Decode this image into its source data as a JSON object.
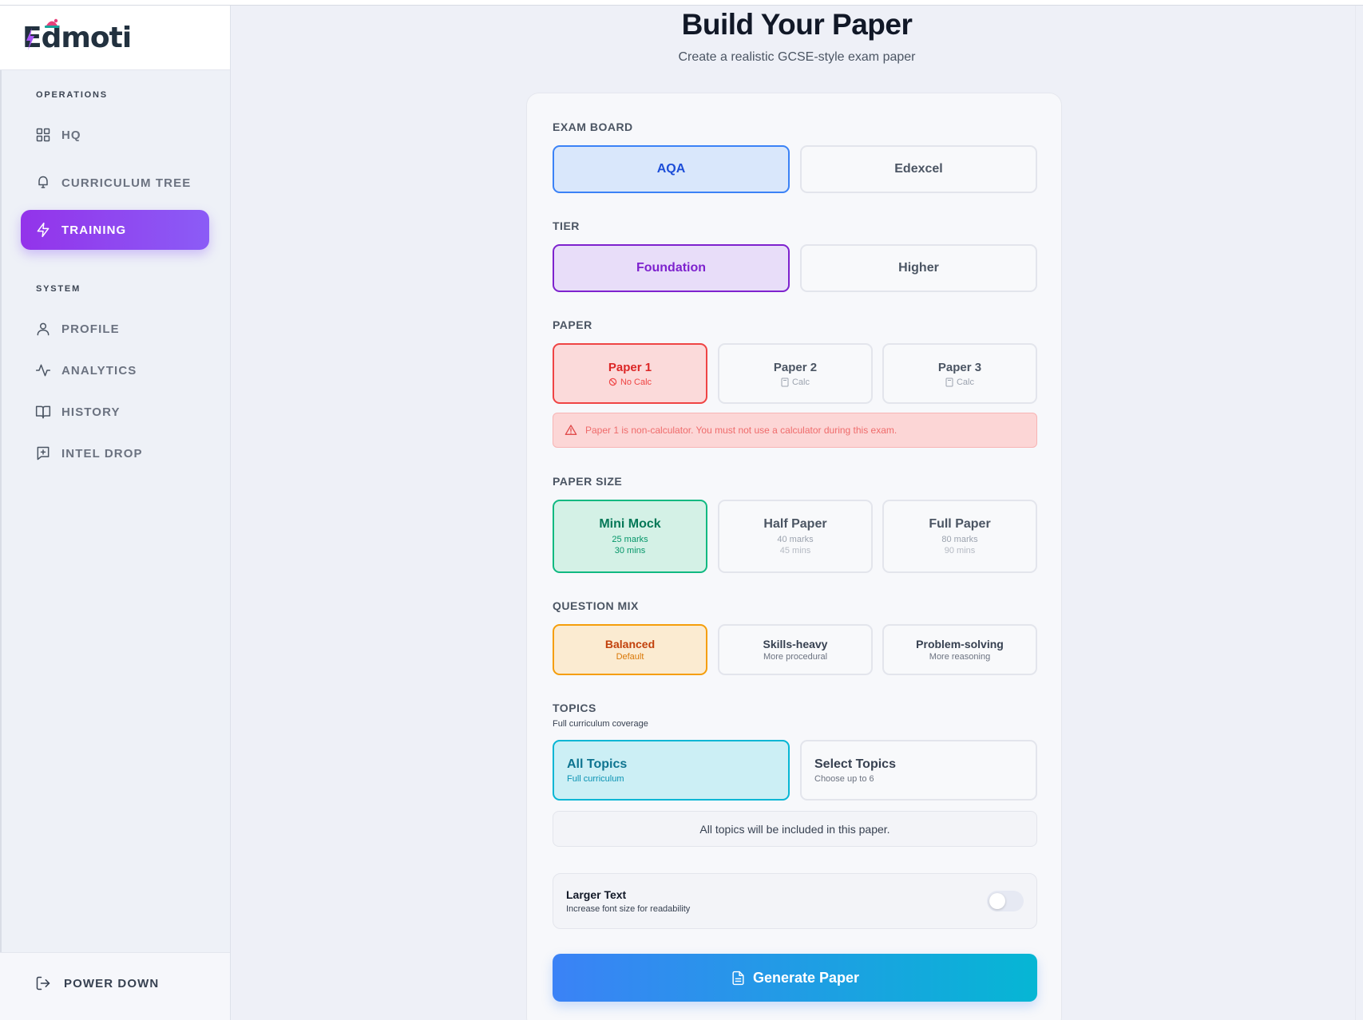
{
  "brand": {
    "name": "Edmoti"
  },
  "sidebar": {
    "sections": {
      "operations": "OPERATIONS",
      "system": "SYSTEM"
    },
    "items": [
      {
        "label": "HQ",
        "icon": "grid-icon"
      },
      {
        "label": "CURRICULUM TREE",
        "icon": "tree-icon"
      },
      {
        "label": "TRAINING",
        "icon": "lightning-icon",
        "active": true
      },
      {
        "label": "PROFILE",
        "icon": "user-icon"
      },
      {
        "label": "ANALYTICS",
        "icon": "activity-icon"
      },
      {
        "label": "HISTORY",
        "icon": "book-icon"
      },
      {
        "label": "INTEL DROP",
        "icon": "message-plus-icon"
      }
    ],
    "power_down": "POWER DOWN"
  },
  "page": {
    "title": "Build Your Paper",
    "subtitle": "Create a realistic GCSE-style exam paper"
  },
  "exam_board": {
    "label": "EXAM BOARD",
    "options": [
      "AQA",
      "Edexcel"
    ],
    "selected": "AQA"
  },
  "tier": {
    "label": "TIER",
    "options": [
      "Foundation",
      "Higher"
    ],
    "selected": "Foundation"
  },
  "paper": {
    "label": "PAPER",
    "options": [
      {
        "title": "Paper 1",
        "sub": "No Calc"
      },
      {
        "title": "Paper 2",
        "sub": "Calc"
      },
      {
        "title": "Paper 3",
        "sub": "Calc"
      }
    ],
    "selected": "Paper 1",
    "warning": "Paper 1 is non-calculator. You must not use a calculator during this exam."
  },
  "paper_size": {
    "label": "PAPER SIZE",
    "options": [
      {
        "title": "Mini Mock",
        "marks": "25 marks",
        "time": "30 mins"
      },
      {
        "title": "Half Paper",
        "marks": "40 marks",
        "time": "45 mins"
      },
      {
        "title": "Full Paper",
        "marks": "80 marks",
        "time": "90 mins"
      }
    ],
    "selected": "Mini Mock"
  },
  "question_mix": {
    "label": "QUESTION MIX",
    "options": [
      {
        "title": "Balanced",
        "sub": "Default"
      },
      {
        "title": "Skills-heavy",
        "sub": "More procedural"
      },
      {
        "title": "Problem-solving",
        "sub": "More reasoning"
      }
    ],
    "selected": "Balanced"
  },
  "topics": {
    "label": "TOPICS",
    "sublabel": "Full curriculum coverage",
    "options": [
      {
        "title": "All Topics",
        "sub": "Full curriculum"
      },
      {
        "title": "Select Topics",
        "sub": "Choose up to 6"
      }
    ],
    "selected": "All Topics",
    "info": "All topics will be included in this paper."
  },
  "larger_text": {
    "title": "Larger Text",
    "sub": "Increase font size for readability",
    "enabled": false
  },
  "generate_button": "Generate Paper",
  "colors": {
    "accent_purple": "#8b5cf6",
    "accent_blue": "#3b82f6",
    "accent_cyan": "#06b6d4"
  }
}
